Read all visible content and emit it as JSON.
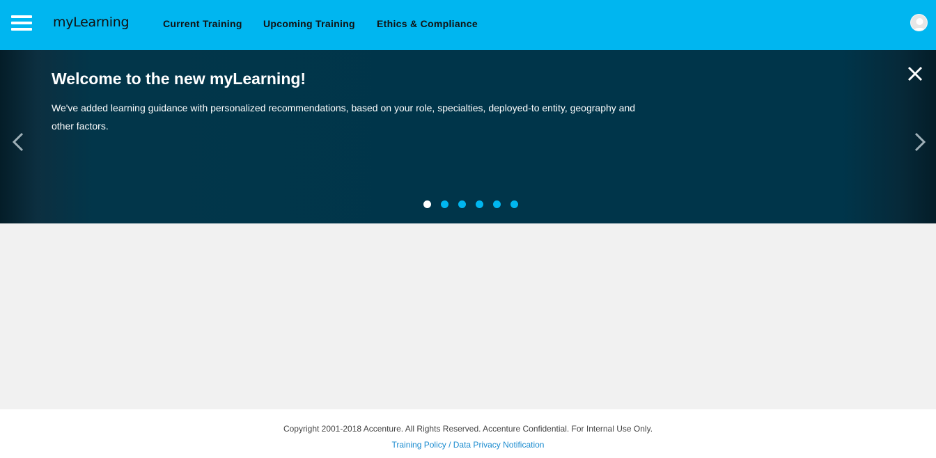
{
  "header": {
    "menu_icon": "hamburger-menu-icon",
    "brand": "myLearning",
    "nav": [
      "Current Training",
      "Upcoming Training",
      "Ethics & Compliance"
    ],
    "avatar_icon": "user-avatar-icon",
    "bg_color": "#00b6f0"
  },
  "banner": {
    "title": "Welcome to the new myLearning!",
    "text": "We've added learning guidance with personalized recommendations, based on your role, specialties, deployed-to entity, geography and other factors.",
    "close_icon": "close-icon",
    "prev_icon": "chevron-left-icon",
    "next_icon": "chevron-right-icon",
    "slide_count": 6,
    "active_slide": 1,
    "bg_color": "#00354a"
  },
  "footer": {
    "copyright": "Copyright 2001-2018 Accenture. All Rights Reserved. Accenture Confidential. For Internal Use Only.",
    "policy_link": "Training Policy / Data Privacy Notification"
  }
}
